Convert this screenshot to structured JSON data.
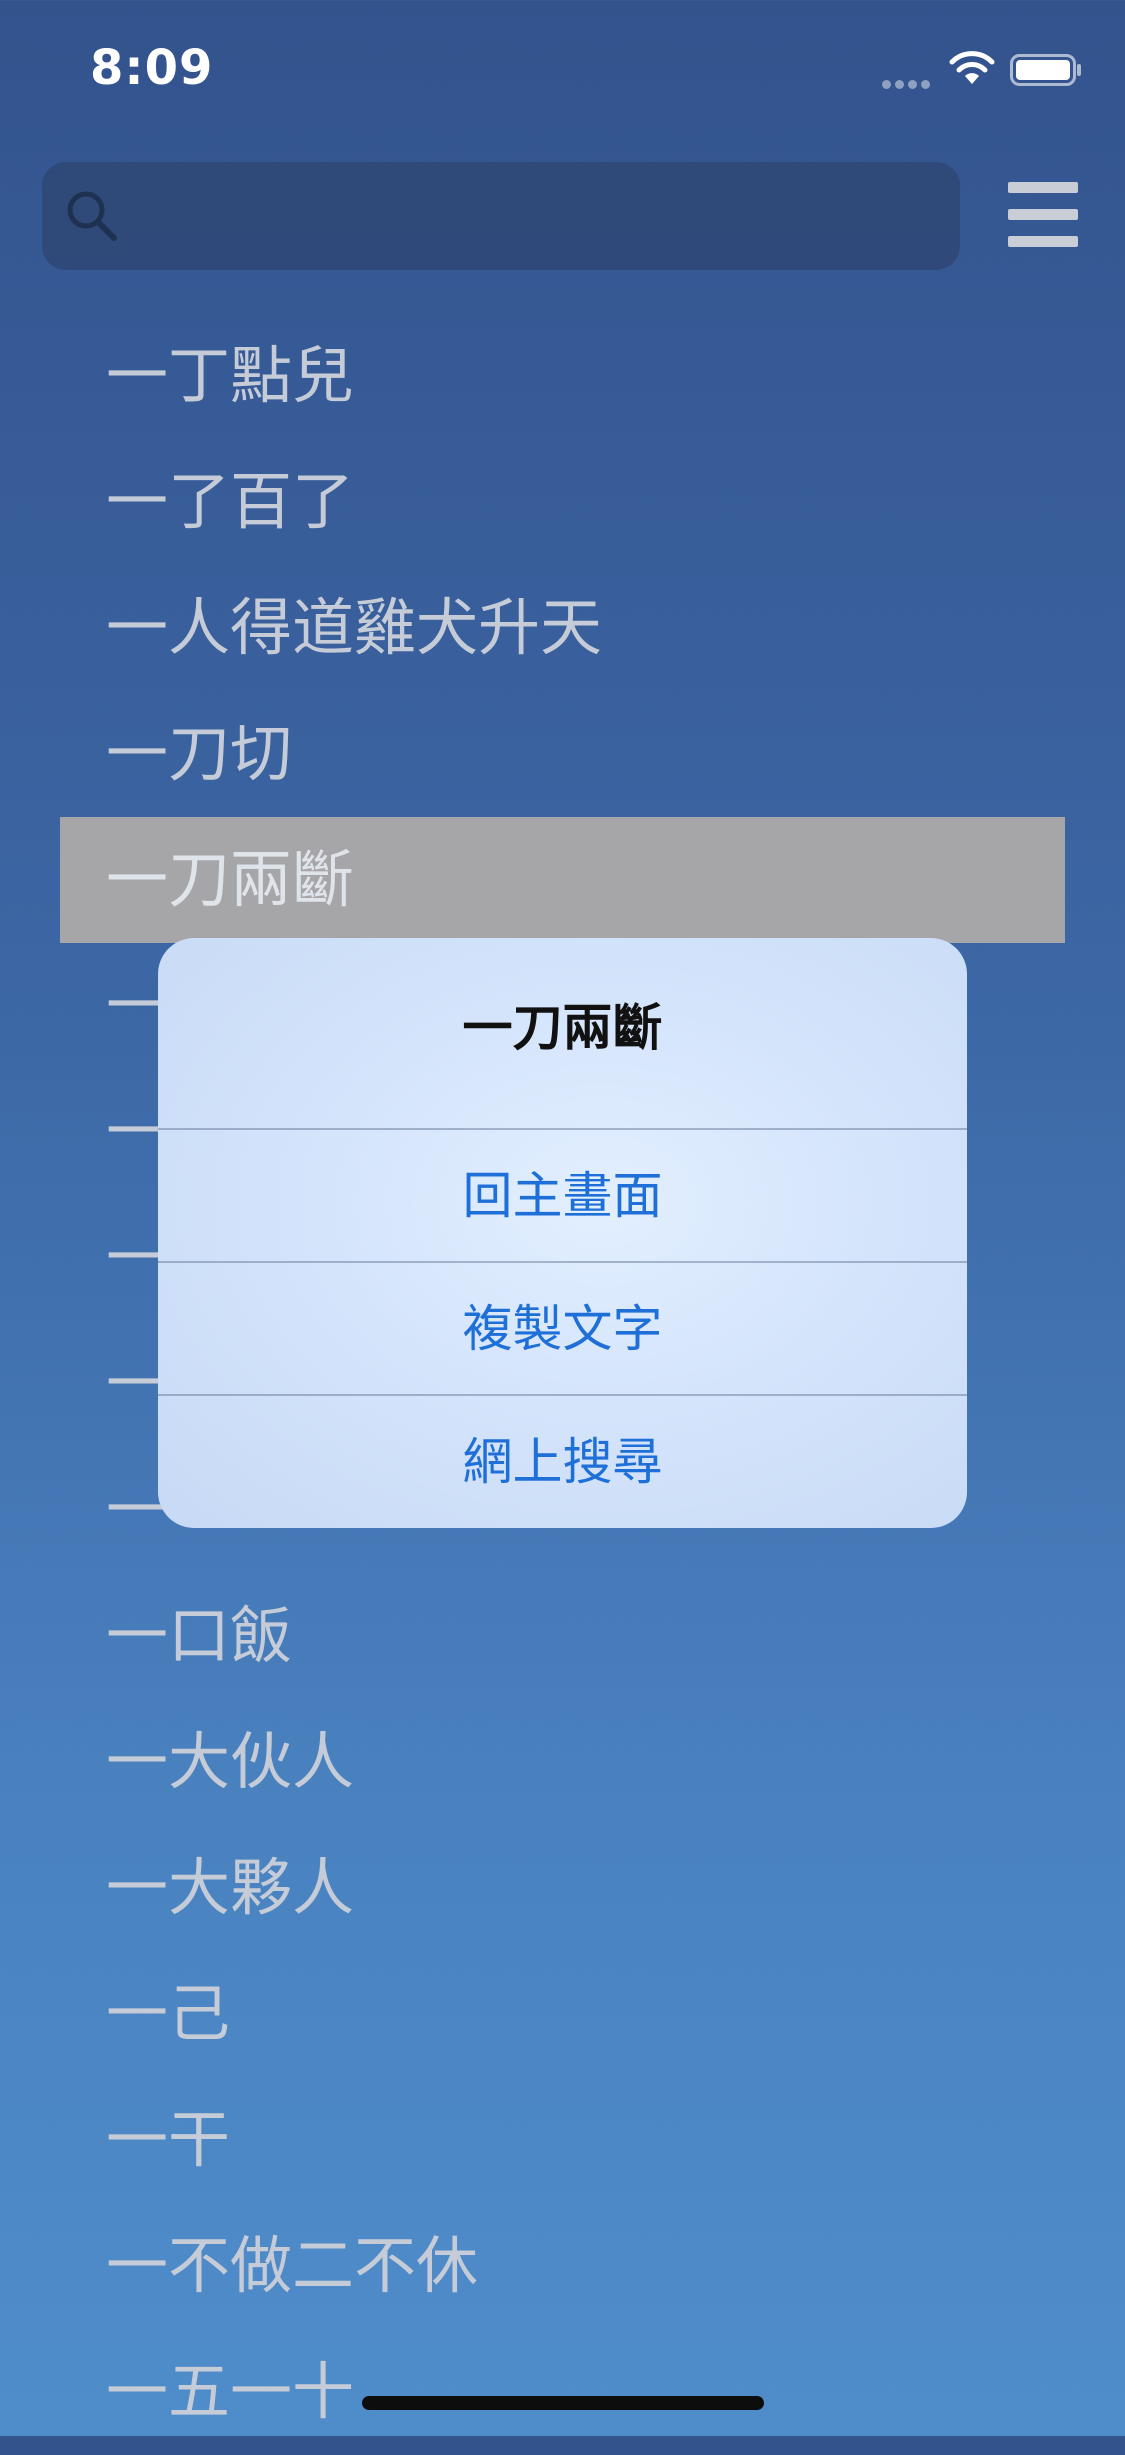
{
  "status_bar": {
    "time": "8:09"
  },
  "search": {
    "placeholder": "",
    "value": "",
    "icon": "search-icon"
  },
  "menu": {
    "icon": "hamburger-menu-icon"
  },
  "list": {
    "items": [
      {
        "label": "一丁點兒",
        "selected": false
      },
      {
        "label": "一了百了",
        "selected": false
      },
      {
        "label": "一人得道雞犬升天",
        "selected": false
      },
      {
        "label": "一刀切",
        "selected": false
      },
      {
        "label": "一刀兩斷",
        "selected": true
      },
      {
        "label": "一",
        "selected": false
      },
      {
        "label": "一",
        "selected": false
      },
      {
        "label": "一",
        "selected": false
      },
      {
        "label": "一",
        "selected": false
      },
      {
        "label": "一",
        "selected": false
      },
      {
        "label": "一口飯",
        "selected": false
      },
      {
        "label": "一大伙人",
        "selected": false
      },
      {
        "label": "一大夥人",
        "selected": false
      },
      {
        "label": "一己",
        "selected": false
      },
      {
        "label": "一干",
        "selected": false
      },
      {
        "label": "一不做二不休",
        "selected": false
      },
      {
        "label": "一五一十",
        "selected": false
      }
    ]
  },
  "alert": {
    "title": "一刀兩斷",
    "actions": [
      {
        "label": "回主畫面"
      },
      {
        "label": "複製文字"
      },
      {
        "label": "網上搜尋"
      }
    ]
  },
  "colors": {
    "background_top": "#33538d",
    "background_bottom": "#4f8dca",
    "selected_row": "#a6a5a8",
    "action_blue": "#1f6fd8"
  }
}
